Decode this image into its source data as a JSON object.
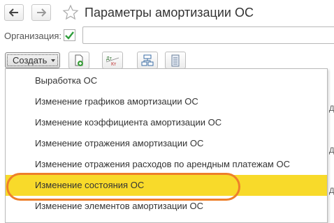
{
  "header": {
    "title": "Параметры амортизации ОС"
  },
  "filter": {
    "organization_label": "Организация:",
    "organization_checked": true,
    "organization_value": ""
  },
  "toolbar": {
    "create_label": "Создать",
    "dtkt_top": "Дт",
    "dtkt_bottom": "Кт"
  },
  "menu": {
    "items": [
      {
        "label": "Выработка ОС"
      },
      {
        "label": "Изменение графиков амортизации ОС"
      },
      {
        "label": "Изменение коэффициента амортизации ОС"
      },
      {
        "label": "Изменение отражения амортизации ОС"
      },
      {
        "label": "Изменение отражения расходов по арендным платежам ОС"
      },
      {
        "label": "Изменение состояния ОС",
        "selected": true
      },
      {
        "label": "Изменение элементов амортизации ОС"
      }
    ]
  },
  "colors": {
    "selected_item": "#f8da2a",
    "highlight_oval": "#ee7f2a",
    "check_green": "#2e9d3a"
  },
  "icons": [
    "back-arrow-icon",
    "forward-arrow-icon",
    "star-icon",
    "checkmark-icon",
    "add-document-icon",
    "dt-kt-icon",
    "structure-icon",
    "list-icon",
    "dropdown-arrow-icon"
  ]
}
